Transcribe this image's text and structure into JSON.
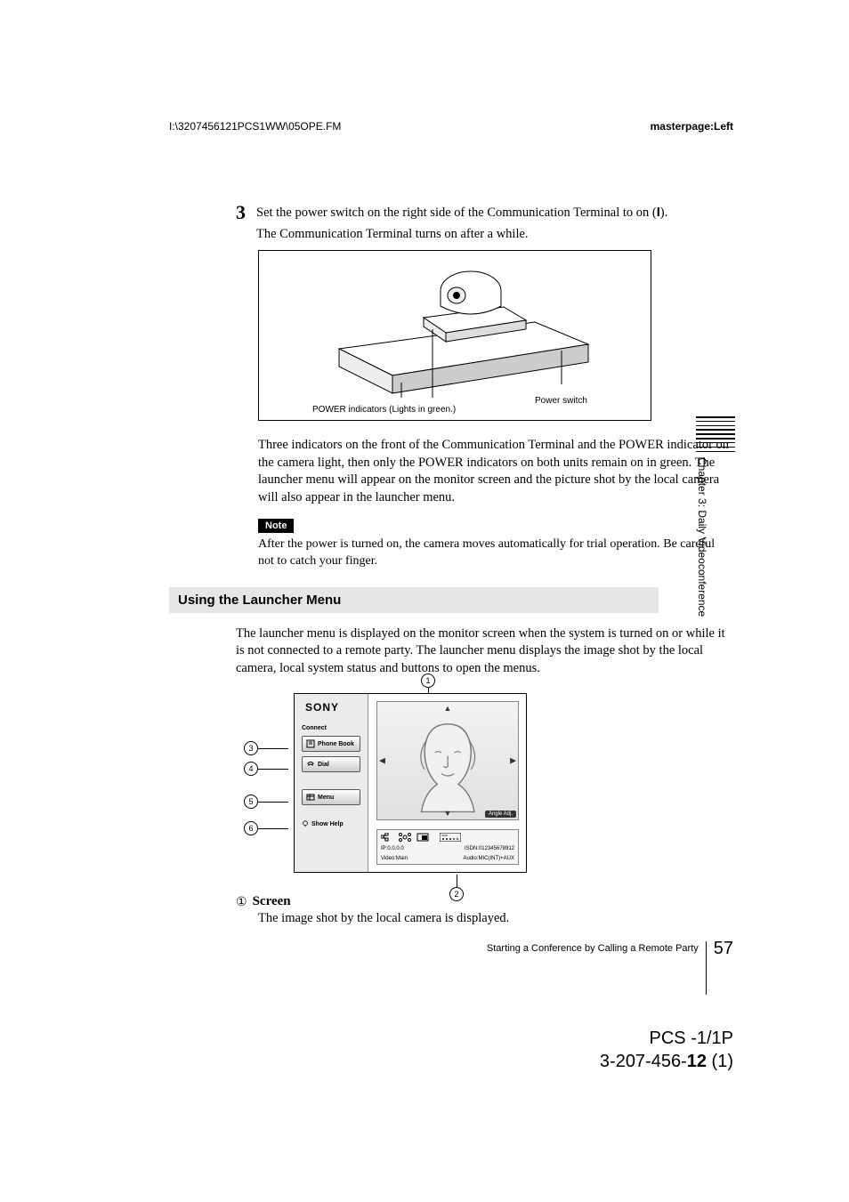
{
  "header": {
    "left": "I:\\3207456121PCS1WW\\05OPE.FM",
    "right": "masterpage:Left"
  },
  "step": {
    "number": "3",
    "line1_a": "Set the power switch on the right side of the Communication Terminal to on (",
    "line1_b": ").",
    "line2": "The Communication Terminal turns on after a while."
  },
  "figure1": {
    "label_left": "POWER indicators (Lights in green.)",
    "label_right": "Power switch"
  },
  "para_after_fig": "Three indicators on the front of the Communication Terminal and the POWER indicator on the camera light, then only the POWER indicators on both units remain on in green. The launcher menu will appear on the monitor screen and the picture shot by the local camera will also appear in the launcher menu.",
  "note": {
    "badge": "Note",
    "text": "After the power is turned on, the camera moves automatically for trial operation. Be careful not to catch your finger."
  },
  "section_heading": "Using the Launcher Menu",
  "intro": "The launcher menu is displayed on the monitor screen when the system is turned on or while it is not connected to a remote party. The launcher menu displays the image shot by the local camera, local system status and buttons to open the menus.",
  "launcher": {
    "logo": "SONY",
    "connect_label": "Connect",
    "phone_book": "Phone Book",
    "dial": "Dial",
    "menu": "Menu",
    "show_help": "Show Help",
    "angle_adj": "Angle Adj.",
    "ip_line": "IP:0.0.0.0",
    "video_line": "Video:Main",
    "isdn_line": "ISDN:012345678912",
    "audio_line": "Audio:MIC(INT)+AUX"
  },
  "callouts": {
    "c1": "1",
    "c2": "2",
    "c3": "3",
    "c4": "4",
    "c5": "5",
    "c6": "6"
  },
  "item": {
    "num": "1",
    "title": "Screen",
    "desc": "The image shot by the local camera is displayed."
  },
  "footer": {
    "text": "Starting a Conference by Calling a Remote Party",
    "page": "57"
  },
  "doc_id": {
    "line1": "PCS -1/1P",
    "line2_a": "3-207-456-",
    "line2_b": "12",
    "line2_c": " (1)"
  },
  "side_tab": "Chapter 3: Daily Videoconference"
}
